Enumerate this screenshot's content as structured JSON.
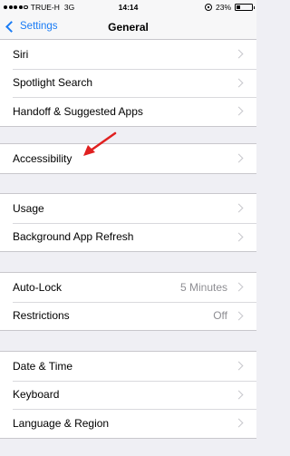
{
  "status_bar": {
    "carrier": "TRUE-H",
    "network": "3G",
    "time": "14:14",
    "battery": "23%",
    "battery_level": 0.23,
    "signal_bars": 4
  },
  "nav": {
    "back_label": "Settings",
    "title": "General"
  },
  "groups": [
    {
      "rows": [
        {
          "label": "Siri",
          "value": ""
        },
        {
          "label": "Spotlight Search",
          "value": ""
        },
        {
          "label": "Handoff & Suggested Apps",
          "value": ""
        }
      ]
    },
    {
      "rows": [
        {
          "label": "Accessibility",
          "value": ""
        }
      ]
    },
    {
      "rows": [
        {
          "label": "Usage",
          "value": ""
        },
        {
          "label": "Background App Refresh",
          "value": ""
        }
      ]
    },
    {
      "rows": [
        {
          "label": "Auto-Lock",
          "value": "5 Minutes"
        },
        {
          "label": "Restrictions",
          "value": "Off"
        }
      ]
    },
    {
      "rows": [
        {
          "label": "Date & Time",
          "value": ""
        },
        {
          "label": "Keyboard",
          "value": ""
        },
        {
          "label": "Language & Region",
          "value": ""
        }
      ]
    }
  ],
  "colors": {
    "accent": "#1a7cf5",
    "annotation_arrow": "#e02020",
    "background": "#efeff4"
  }
}
